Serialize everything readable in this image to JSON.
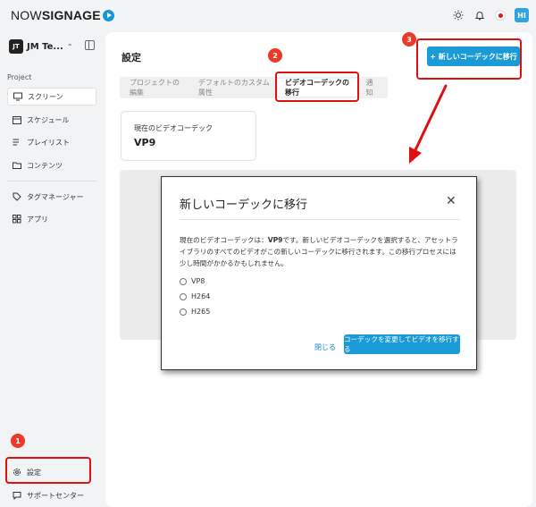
{
  "brand": {
    "logo_now": "NOW",
    "logo_rest": "SIGNAGE"
  },
  "header": {
    "user_initials": "HI"
  },
  "sidebar": {
    "workspace_badge": "JT",
    "workspace_name": "JM Te...",
    "section_label": "Project",
    "items": [
      {
        "label": "スクリーン",
        "icon": "monitor-icon"
      },
      {
        "label": "スケジュール",
        "icon": "calendar-icon"
      },
      {
        "label": "プレイリスト",
        "icon": "playlist-icon"
      },
      {
        "label": "コンテンツ",
        "icon": "folder-icon"
      },
      {
        "label": "タグマネージャー",
        "icon": "tag-icon"
      },
      {
        "label": "アプリ",
        "icon": "apps-icon"
      }
    ],
    "settings_label": "設定",
    "support_label": "サポートセンター"
  },
  "main": {
    "title": "設定",
    "migrate_button": "+ 新しいコーデックに移行",
    "tabs": [
      {
        "label": "プロジェクトの編集"
      },
      {
        "label": "デフォルトのカスタム属性"
      },
      {
        "label": "ビデオコーデックの移行"
      },
      {
        "label": "通知"
      }
    ],
    "current_codec_label": "現在のビデオコーデック",
    "current_codec_value": "VP9"
  },
  "modal": {
    "title": "新しいコーデックに移行",
    "desc_prefix": "現在のビデオコーデックは：",
    "desc_codec": "VP9",
    "desc_suffix": "です。新しいビデオコーデックを選択すると、アセットライブラリのすべてのビデオがこの新しいコーデックに移行されます。この移行プロセスには少し時間がかかるかもしれません。",
    "options": [
      "VP8",
      "H264",
      "H265"
    ],
    "close_label": "閉じる",
    "confirm_label": "コーデックを変更してビデオを移行する"
  },
  "annotations": {
    "step1": "1",
    "step2": "2",
    "step3": "3"
  },
  "colors": {
    "accent": "#1a9ad6",
    "annotation_red": "#e01010"
  }
}
